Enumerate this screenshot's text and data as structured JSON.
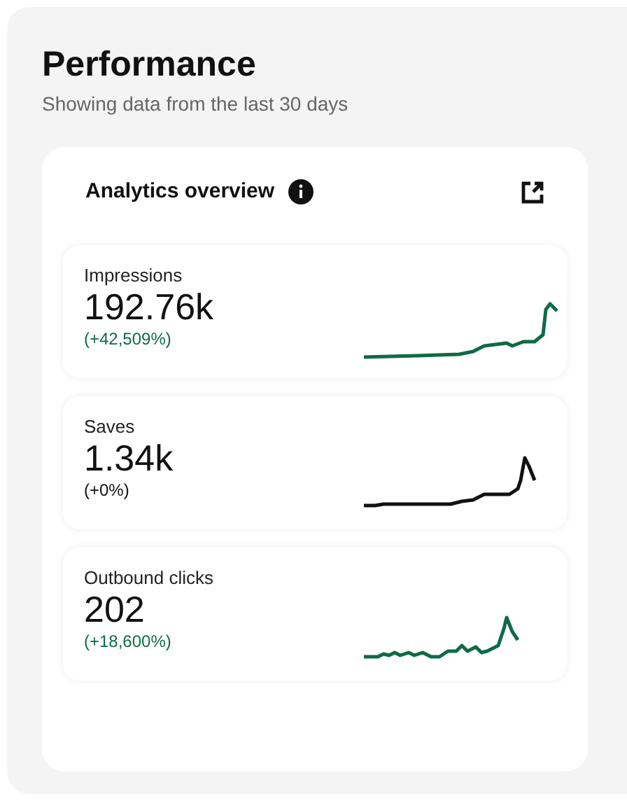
{
  "header": {
    "title": "Performance",
    "subtitle": "Showing data from the last 30 days"
  },
  "card": {
    "title": "Analytics overview"
  },
  "metrics": [
    {
      "label": "Impressions",
      "value": "192.76k",
      "change": "(+42,509%)",
      "color": "#0e6b45"
    },
    {
      "label": "Saves",
      "value": "1.34k",
      "change": "(+0%)",
      "color": "#111111"
    },
    {
      "label": "Outbound clicks",
      "value": "202",
      "change": "(+18,600%)",
      "color": "#0e6b45"
    }
  ]
}
